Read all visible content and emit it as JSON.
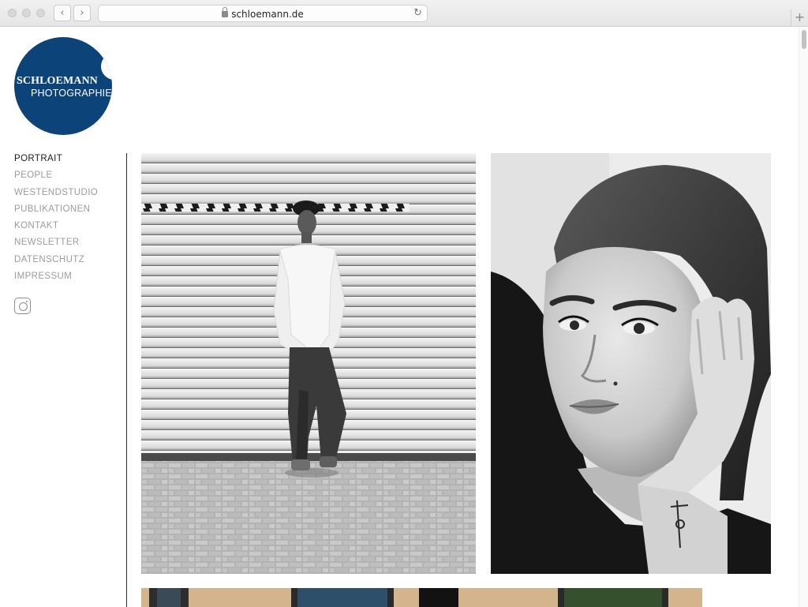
{
  "browser": {
    "url": "schloemann.de",
    "back_glyph": "‹",
    "forward_glyph": "›",
    "reload_glyph": "↻",
    "newtab_glyph": "+"
  },
  "logo": {
    "line1": "SCHLOEMANN",
    "line2": "PHOTOGRAPHIE",
    "color": "#0c4479"
  },
  "nav": {
    "items": [
      {
        "label": "PORTRAIT",
        "active": true
      },
      {
        "label": "PEOPLE",
        "active": false
      },
      {
        "label": "WESTENDSTUDIO",
        "active": false
      },
      {
        "label": "PUBLIKATIONEN",
        "active": false
      },
      {
        "label": "KONTAKT",
        "active": false
      },
      {
        "label": "NEWSLETTER",
        "active": false
      },
      {
        "label": "DATENSCHUTZ",
        "active": false
      },
      {
        "label": "IMPRESSUM",
        "active": false
      }
    ],
    "social_icon": "instagram-icon"
  },
  "gallery": {
    "photos": [
      {
        "subject": "man-standing-in-front-of-roller-shutter",
        "style": "black-and-white"
      },
      {
        "subject": "woman-closeup-hand-on-face",
        "style": "black-and-white"
      },
      {
        "subject": "building-facade-with-windows",
        "style": "color"
      }
    ]
  }
}
